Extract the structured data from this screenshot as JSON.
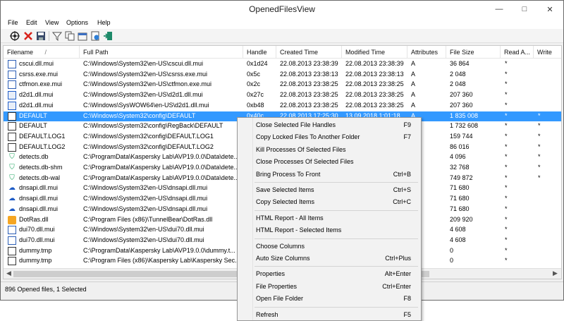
{
  "window": {
    "title": "OpenedFilesView",
    "controls": [
      "—",
      "□",
      "✕"
    ]
  },
  "menubar": [
    "File",
    "Edit",
    "View",
    "Options",
    "Help"
  ],
  "toolbar": [
    "target-icon",
    "close-handles-icon",
    "save-icon",
    "filter-icon",
    "copy-icon",
    "properties-icon",
    "html-report-icon",
    "exit-icon"
  ],
  "columns": [
    "Filename",
    "Full Path",
    "Handle",
    "Created Time",
    "Modified Time",
    "Attributes",
    "File Size",
    "Read A...",
    "Write"
  ],
  "rows": [
    {
      "icon": "mui",
      "filename": "cscui.dll.mui",
      "path": "C:\\Windows\\System32\\en-US\\cscui.dll.mui",
      "handle": "0x1d24",
      "created": "22.08.2013 23:38:39",
      "modified": "22.08.2013 23:38:39",
      "attr": "A",
      "size": "36 864",
      "read": "*",
      "write": ""
    },
    {
      "icon": "mui",
      "filename": "csrss.exe.mui",
      "path": "C:\\Windows\\System32\\en-US\\csrss.exe.mui",
      "handle": "0x5c",
      "created": "22.08.2013 23:38:13",
      "modified": "22.08.2013 23:38:13",
      "attr": "A",
      "size": "2 048",
      "read": "*",
      "write": ""
    },
    {
      "icon": "mui",
      "filename": "ctfmon.exe.mui",
      "path": "C:\\Windows\\System32\\en-US\\ctfmon.exe.mui",
      "handle": "0x2c",
      "created": "22.08.2013 23:38:25",
      "modified": "22.08.2013 23:38:25",
      "attr": "A",
      "size": "2 048",
      "read": "*",
      "write": ""
    },
    {
      "icon": "dll",
      "filename": "d2d1.dll.mui",
      "path": "C:\\Windows\\System32\\en-US\\d2d1.dll.mui",
      "handle": "0x27c",
      "created": "22.08.2013 23:38:25",
      "modified": "22.08.2013 23:38:25",
      "attr": "A",
      "size": "207 360",
      "read": "*",
      "write": ""
    },
    {
      "icon": "dll",
      "filename": "d2d1.dll.mui",
      "path": "C:\\Windows\\SysWOW64\\en-US\\d2d1.dll.mui",
      "handle": "0xb48",
      "created": "22.08.2013 23:38:25",
      "modified": "22.08.2013 23:38:25",
      "attr": "A",
      "size": "207 360",
      "read": "*",
      "write": ""
    },
    {
      "icon": "file",
      "filename": "DEFAULT",
      "path": "C:\\Windows\\System32\\config\\DEFAULT",
      "handle": "0x40c",
      "created": "22.08.2013 17:25:30",
      "modified": "13.09.2018 1:01:18",
      "attr": "A",
      "size": "1 835 008",
      "read": "*",
      "write": "*",
      "selected": true
    },
    {
      "icon": "file",
      "filename": "DEFAULT",
      "path": "C:\\Windows\\System32\\config\\RegBack\\DEFAULT",
      "handle": "",
      "created": "",
      "modified": "",
      "attr": "",
      "size": "1 732 608",
      "read": "*",
      "write": "*"
    },
    {
      "icon": "file",
      "filename": "DEFAULT.LOG1",
      "path": "C:\\Windows\\System32\\config\\DEFAULT.LOG1",
      "handle": "",
      "created": "",
      "modified": "",
      "attr": "",
      "size": "159 744",
      "read": "*",
      "write": "*"
    },
    {
      "icon": "file",
      "filename": "DEFAULT.LOG2",
      "path": "C:\\Windows\\System32\\config\\DEFAULT.LOG2",
      "handle": "",
      "created": "",
      "modified": "",
      "attr": "",
      "size": "86 016",
      "read": "*",
      "write": "*"
    },
    {
      "icon": "shield",
      "filename": "detects.db",
      "path": "C:\\ProgramData\\Kaspersky Lab\\AVP19.0.0\\Data\\dete...",
      "handle": "",
      "created": "",
      "modified": "",
      "attr": "",
      "size": "4 096",
      "read": "*",
      "write": "*"
    },
    {
      "icon": "shield",
      "filename": "detects.db-shm",
      "path": "C:\\ProgramData\\Kaspersky Lab\\AVP19.0.0\\Data\\dete...",
      "handle": "",
      "created": "",
      "modified": "",
      "attr": "",
      "size": "32 768",
      "read": "*",
      "write": "*"
    },
    {
      "icon": "shield",
      "filename": "detects.db-wal",
      "path": "C:\\ProgramData\\Kaspersky Lab\\AVP19.0.0\\Data\\dete...",
      "handle": "",
      "created": "",
      "modified": "",
      "attr": "",
      "size": "749 872",
      "read": "*",
      "write": "*"
    },
    {
      "icon": "cloud",
      "filename": "dnsapi.dll.mui",
      "path": "C:\\Windows\\System32\\en-US\\dnsapi.dll.mui",
      "handle": "",
      "created": "",
      "modified": "",
      "attr": "",
      "size": "71 680",
      "read": "*",
      "write": ""
    },
    {
      "icon": "cloud",
      "filename": "dnsapi.dll.mui",
      "path": "C:\\Windows\\System32\\en-US\\dnsapi.dll.mui",
      "handle": "",
      "created": "",
      "modified": "",
      "attr": "",
      "size": "71 680",
      "read": "*",
      "write": ""
    },
    {
      "icon": "cloud",
      "filename": "dnsapi.dll.mui",
      "path": "C:\\Windows\\System32\\en-US\\dnsapi.dll.mui",
      "handle": "",
      "created": "",
      "modified": "",
      "attr": "",
      "size": "71 680",
      "read": "*",
      "write": ""
    },
    {
      "icon": "bear",
      "filename": "DotRas.dll",
      "path": "C:\\Program Files (x86)\\TunnelBear\\DotRas.dll",
      "handle": "",
      "created": "",
      "modified": "",
      "attr": "",
      "size": "209 920",
      "read": "*",
      "write": ""
    },
    {
      "icon": "mui",
      "filename": "dui70.dll.mui",
      "path": "C:\\Windows\\System32\\en-US\\dui70.dll.mui",
      "handle": "",
      "created": "",
      "modified": "",
      "attr": "",
      "size": "4 608",
      "read": "*",
      "write": ""
    },
    {
      "icon": "mui",
      "filename": "dui70.dll.mui",
      "path": "C:\\Windows\\System32\\en-US\\dui70.dll.mui",
      "handle": "",
      "created": "",
      "modified": "",
      "attr": "",
      "size": "4 608",
      "read": "*",
      "write": ""
    },
    {
      "icon": "file",
      "filename": "dummy.tmp",
      "path": "C:\\ProgramData\\Kaspersky Lab\\AVP19.0.0\\dummy.t...",
      "handle": "",
      "created": "",
      "modified": "",
      "attr": "",
      "size": "0",
      "read": "*",
      "write": ""
    },
    {
      "icon": "file",
      "filename": "dummy.tmp",
      "path": "C:\\Program Files (x86)\\Kaspersky Lab\\Kaspersky Sec...",
      "handle": "",
      "created": "",
      "modified": "",
      "attr": "",
      "size": "0",
      "read": "*",
      "write": ""
    }
  ],
  "status": "896 Opened files, 1 Selected",
  "context_menu": [
    {
      "label": "Close Selected File Handles",
      "shortcut": "F9"
    },
    {
      "label": "Copy Locked Files To Another Folder",
      "shortcut": "F7"
    },
    {
      "label": "Kill Processes Of Selected Files",
      "shortcut": ""
    },
    {
      "label": "Close Processes Of Selected Files",
      "shortcut": ""
    },
    {
      "label": "Bring Process To Front",
      "shortcut": "Ctrl+B"
    },
    {
      "separator": true
    },
    {
      "label": "Save Selected Items",
      "shortcut": "Ctrl+S"
    },
    {
      "label": "Copy Selected Items",
      "shortcut": "Ctrl+C"
    },
    {
      "separator": true
    },
    {
      "label": "HTML Report - All Items",
      "shortcut": ""
    },
    {
      "label": "HTML Report - Selected Items",
      "shortcut": ""
    },
    {
      "separator": true
    },
    {
      "label": "Choose Columns",
      "shortcut": ""
    },
    {
      "label": "Auto Size Columns",
      "shortcut": "Ctrl+Plus"
    },
    {
      "separator": true
    },
    {
      "label": "Properties",
      "shortcut": "Alt+Enter"
    },
    {
      "label": "File Properties",
      "shortcut": "Ctrl+Enter"
    },
    {
      "label": "Open File Folder",
      "shortcut": "F8"
    },
    {
      "separator": true
    },
    {
      "label": "Refresh",
      "shortcut": "F5"
    }
  ],
  "colors": {
    "selection": "#3399ff",
    "shield": "#1aa35c",
    "cloud": "#1e5bc6"
  }
}
